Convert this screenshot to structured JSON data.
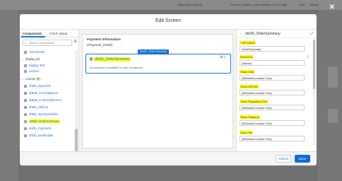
{
  "background": {
    "autolayout_label": "Auto-Layout (Beta)",
    "version_status": "Version 5: Active—Last modified 16 days ago",
    "run_label": "Run",
    "debug_label": "Debug"
  },
  "modal": {
    "title": "Edit Screen",
    "cancel_label": "Cancel",
    "done_label": "Done"
  },
  "left_panel": {
    "tabs": [
      "Components",
      "Fields (Beta)"
    ],
    "search_placeholder": "Search components...",
    "top_item": "Visit Details",
    "display_group": "Display (2)",
    "display_items": [
      "Display Text",
      "Section"
    ],
    "custom_group": "Custom (8)",
    "custom_items": [
      "drb2b_BuyerInfo",
      "drB2B_CcCompliance",
      "drB2B_CcTermsElement",
      "drb2b_CtRList",
      "drb2b_MyTaxIdentifier",
      "drb2b_OrderSummary",
      "drb2b_Payments",
      "drb2b_taxIdentifier"
    ],
    "appexchange_label": "Get more on the AppExchange"
  },
  "canvas": {
    "section_title": "Payment Information",
    "section_api": "{!Payment_Detail}",
    "component_tag": "drb2b_OrderSummary",
    "component_name": "drb2b_OrderSummary",
    "preview_text": "No preview is available for this component."
  },
  "right_panel": {
    "title": "drb2b_OrderSummary",
    "fields": [
      {
        "label": "* API Name",
        "value": "OrderSummary"
      },
      {
        "label": "Record Id",
        "value": "{!Name}"
      },
      {
        "label": "Show Duty",
        "value": "{!$GlobalConstant.True}"
      },
      {
        "label": "Show IOR fee",
        "value": "{!$GlobalConstant.True}"
      },
      {
        "label": "Show Regulatory Fee",
        "value": "{!$GlobalConstant.True}"
      },
      {
        "label": "Show Shipping",
        "value": "{!$GlobalConstant.True}"
      },
      {
        "label": "Show Tax",
        "value": "{!$GlobalConstant.True}"
      }
    ]
  }
}
